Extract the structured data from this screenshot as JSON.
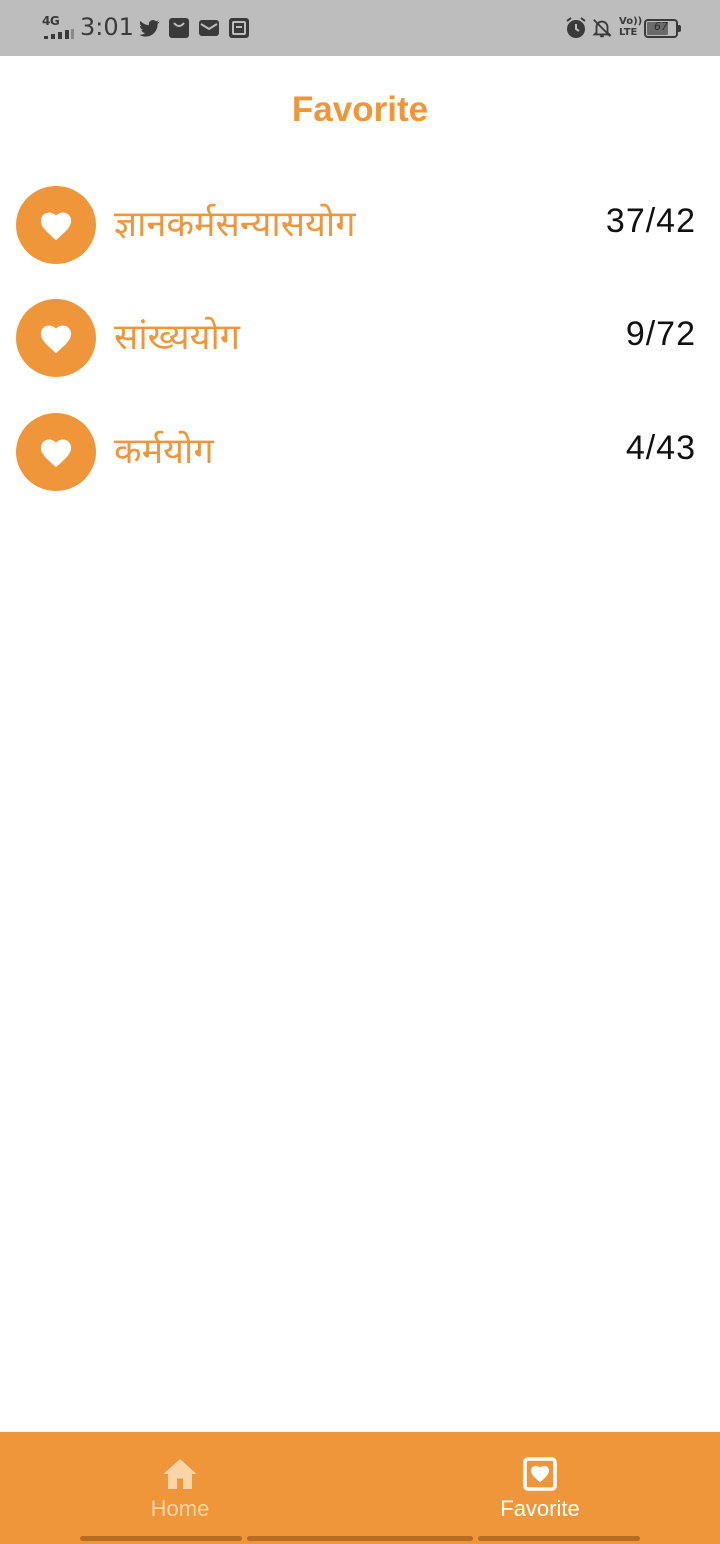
{
  "status_bar": {
    "network": "4G",
    "time": "3:01",
    "left_icons": [
      "twitter-icon",
      "shopping-bag-icon",
      "mail-icon",
      "inbox-icon"
    ],
    "right_icons": [
      "alarm-icon",
      "bell-off-icon"
    ],
    "volte_line1": "Vo))",
    "volte_line2": "LTE",
    "battery_level": "67"
  },
  "header": {
    "title": "Favorite"
  },
  "favorites": [
    {
      "name": "ज्ञानकर्मसन्यासयोग",
      "count": "37/42"
    },
    {
      "name": "सांख्ययोग",
      "count": "9/72"
    },
    {
      "name": "कर्मयोग",
      "count": "4/43"
    }
  ],
  "bottom_nav": {
    "items": [
      {
        "label": "Home",
        "icon": "home-icon",
        "active": false
      },
      {
        "label": "Favorite",
        "icon": "heart-square-icon",
        "active": true
      }
    ]
  },
  "colors": {
    "accent": "#f0963a",
    "status_bar_bg": "#bdbdbd",
    "nav_inactive": "#fbd4a8",
    "nav_active": "#ffffff"
  }
}
